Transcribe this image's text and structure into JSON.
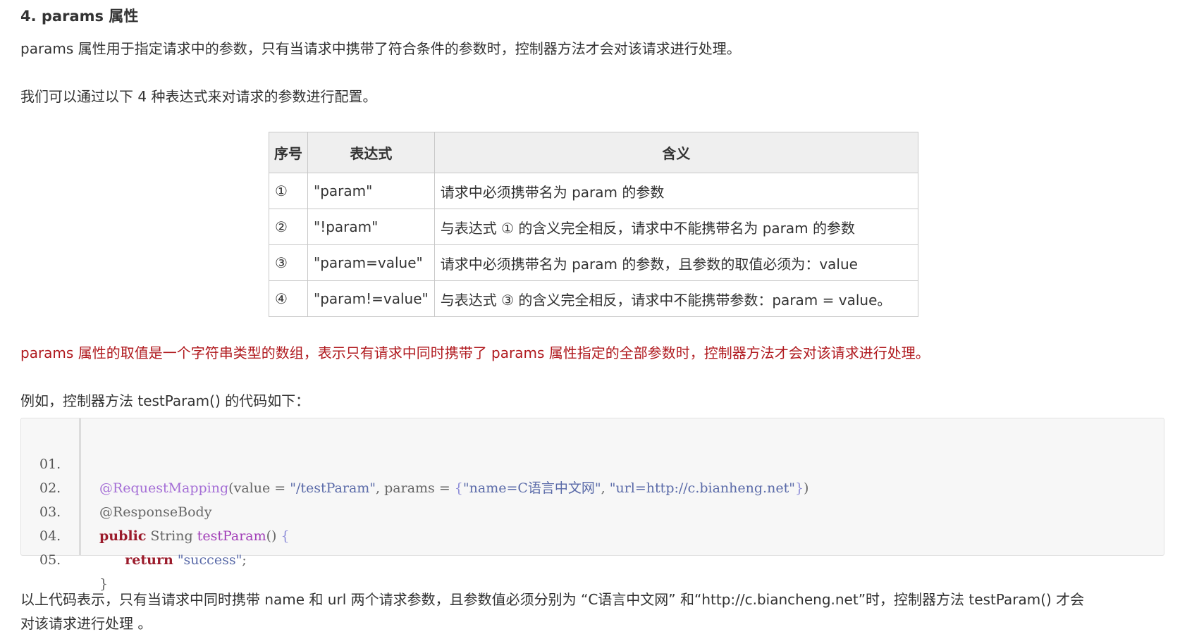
{
  "heading": "4. params 属性",
  "intro": "params 属性用于指定请求中的参数，只有当请求中携带了符合条件的参数时，控制器方法才会对该请求进行处理。",
  "lead": "我们可以通过以下 4 种表达式来对请求的参数进行配置。",
  "table": {
    "headers": [
      "序号",
      "表达式",
      "含义"
    ],
    "rows": [
      {
        "num": "①",
        "expr": " \"param\"",
        "meaning": "请求中必须携带名为 param 的参数"
      },
      {
        "num": "②",
        "expr": "\"!param\"",
        "meaning": "与表达式 ① 的含义完全相反，请求中不能携带名为 param 的参数"
      },
      {
        "num": "③",
        "expr": "\"param=value\"",
        "meaning": "请求中必须携带名为 param 的参数，且参数的取值必须为：value"
      },
      {
        "num": "④",
        "expr": "\"param!=value\"",
        "meaning": "与表达式 ③ 的含义完全相反，请求中不能携带参数：param = value。"
      }
    ]
  },
  "note": "params 属性的取值是一个字符串类型的数组，表示只有请求中同时携带了 params 属性指定的全部参数时，控制器方法才会对该请求进行处理。",
  "example_intro": "例如，控制器方法 testParam() 的代码如下：",
  "code": {
    "line_numbers": [
      "01.",
      "02.",
      "03.",
      "04.",
      "05."
    ],
    "l1_annotation": "@RequestMapping",
    "l1_a": "(value = ",
    "l1_s1": "\"/testParam\"",
    "l1_b": ", params = ",
    "l1_brace_open": "{",
    "l1_s2": "\"name=C语言中文网\"",
    "l1_c": ", ",
    "l1_s3": "\"url=http://c.bianheng.net\"",
    "l1_brace_close": "}",
    "l1_d": ")",
    "l2": "@ResponseBody",
    "l3_kw": "public",
    "l3_type": " String ",
    "l3_fn": "testParam",
    "l3_rest": "() ",
    "l3_brace": "{",
    "l4_indent": "      ",
    "l4_kw": "return",
    "l4_sp": " ",
    "l4_str": "\"success\"",
    "l4_end": ";",
    "l5": "}"
  },
  "conclusion_line1": "以上代码表示，只有当请求中同时携带 name 和 url 两个请求参数，且参数值必须分别为 “C语言中文网” 和“http://c.biancheng.net”时，控制器方法 testParam() 才会",
  "conclusion_line2": "对该请求进行处理 。"
}
